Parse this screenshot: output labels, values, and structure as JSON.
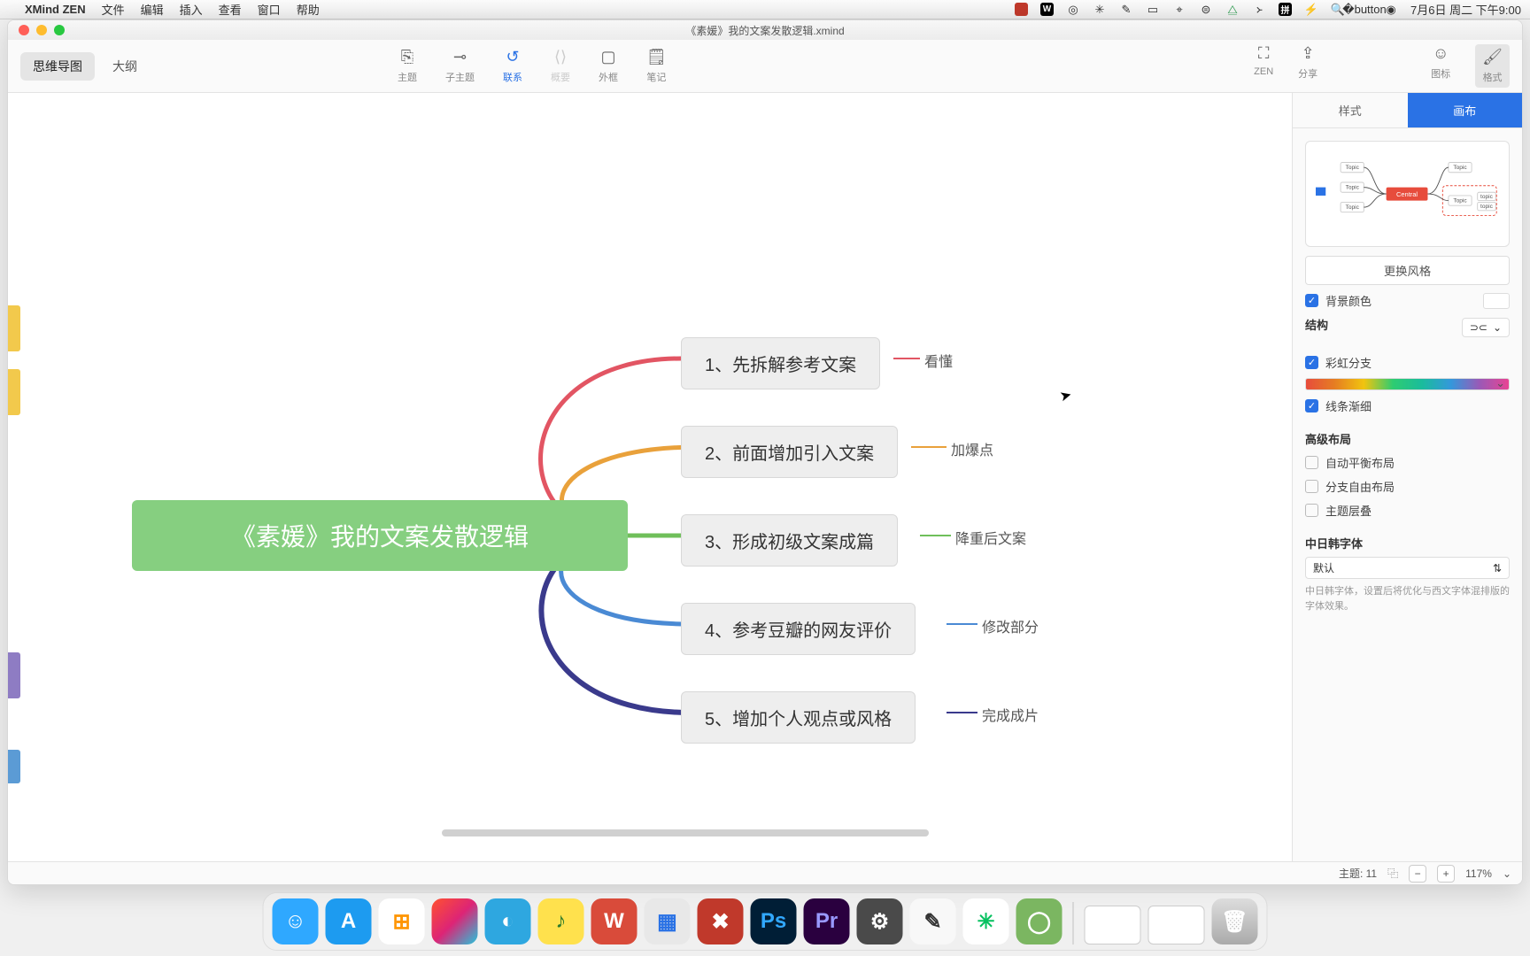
{
  "menubar": {
    "app": "XMind ZEN",
    "items": [
      "文件",
      "编辑",
      "插入",
      "查看",
      "窗口",
      "帮助"
    ],
    "clock": "7月6日 周二 下午9:00"
  },
  "window": {
    "title": "《素媛》我的文案发散逻辑.xmind"
  },
  "tabs": {
    "mindmap": "思维导图",
    "outline": "大纲"
  },
  "tools": {
    "topic": "主题",
    "subtopic": "子主题",
    "relation": "联系",
    "summary": "概要",
    "boundary": "外框",
    "note": "笔记",
    "zen": "ZEN",
    "share": "分享",
    "icons": "图标",
    "format": "格式"
  },
  "mindmap": {
    "central": "《素媛》我的文案发散逻辑",
    "nodes": [
      {
        "text": "1、先拆解参考文案",
        "sub": "看懂",
        "color": "#e25563"
      },
      {
        "text": "2、前面增加引入文案",
        "sub": "加爆点",
        "color": "#e9a13b"
      },
      {
        "text": "3、形成初级文案成篇",
        "sub": "降重后文案",
        "color": "#6fbf5a"
      },
      {
        "text": "4、参考豆瓣的网友评价",
        "sub": "修改部分",
        "color": "#4a8ad4"
      },
      {
        "text": "5、增加个人观点或风格",
        "sub": "完成成片",
        "color": "#3a3a8c"
      }
    ]
  },
  "panel": {
    "tabs": {
      "style": "样式",
      "canvas": "画布"
    },
    "change_style": "更换风格",
    "bg_color": "背景颜色",
    "structure": "结构",
    "rainbow": "彩虹分支",
    "taper": "线条渐细",
    "advanced": "高级布局",
    "auto_balance": "自动平衡布局",
    "free_branch": "分支自由布局",
    "topic_layer": "主题层叠",
    "cjk": "中日韩字体",
    "cjk_default": "默认",
    "cjk_hint": "中日韩字体，设置后将优化与西文字体混排版的字体效果。",
    "preview": {
      "central": "Central",
      "topic": "Topic",
      "sub": "topic"
    }
  },
  "statusbar": {
    "topics_label": "主题:",
    "topics": "11",
    "zoom": "117%"
  },
  "dock": [
    {
      "bg": "#2fa8ff",
      "txt": "☺"
    },
    {
      "bg": "#1d9bf0",
      "txt": "A"
    },
    {
      "bg": "#ffffff",
      "txt": "⊞",
      "fg": "#ff9500"
    },
    {
      "bg": "linear-gradient(135deg,#ff512f,#dd2476,#24c6dc)",
      "txt": ""
    },
    {
      "bg": "#2ea7e0",
      "txt": "◐"
    },
    {
      "bg": "#ffe14d",
      "txt": "♪",
      "fg": "#2b7a2b"
    },
    {
      "bg": "#d94b3a",
      "txt": "W"
    },
    {
      "bg": "#e8e8e8",
      "txt": "▦",
      "fg": "#2a72e5"
    },
    {
      "bg": "#c0392b",
      "txt": "✖"
    },
    {
      "bg": "#001e36",
      "txt": "Ps",
      "fg": "#31a8ff"
    },
    {
      "bg": "#2a003f",
      "txt": "Pr",
      "fg": "#9999ff"
    },
    {
      "bg": "#4a4a4a",
      "txt": "⚙"
    },
    {
      "bg": "#f8f8f8",
      "txt": "✎",
      "fg": "#333"
    },
    {
      "bg": "#ffffff",
      "txt": "✳",
      "fg": "#07c160"
    },
    {
      "bg": "#7bb661",
      "txt": "◯"
    }
  ]
}
